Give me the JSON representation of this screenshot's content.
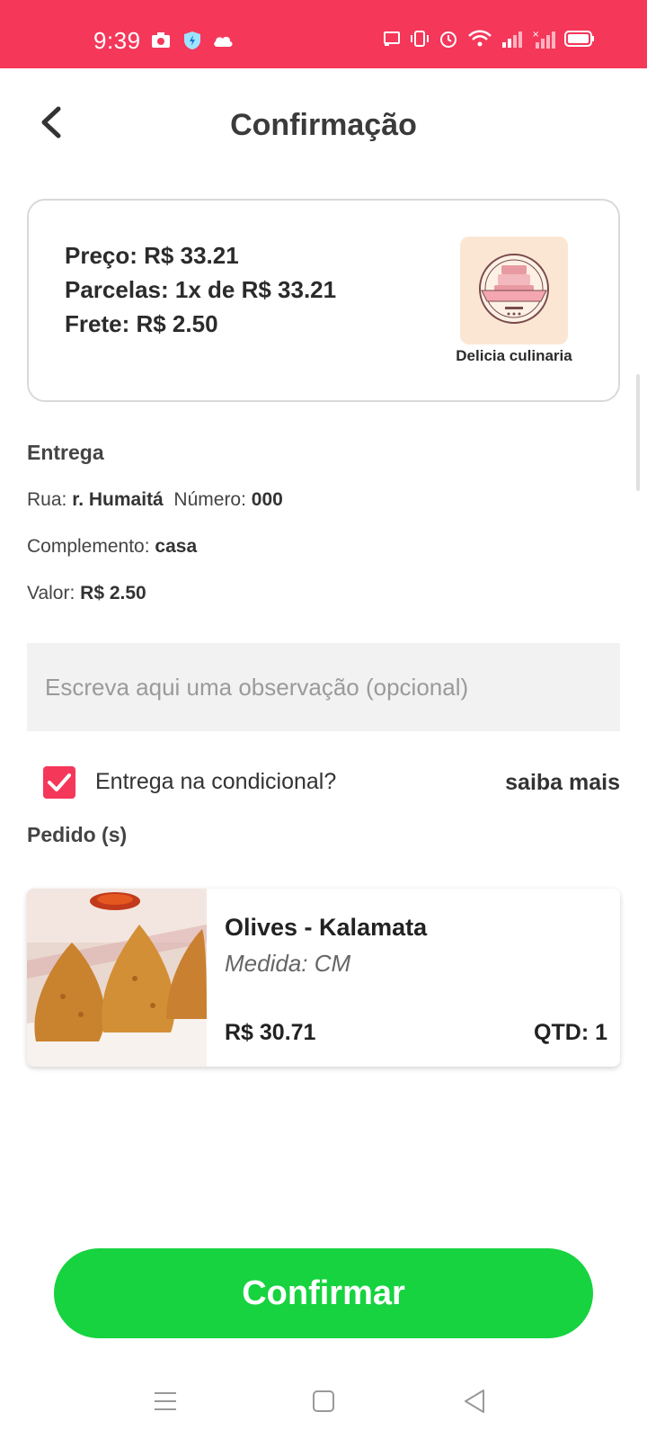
{
  "status_bar": {
    "time": "9:39",
    "bg_color": "#f5375a",
    "left_icons": [
      "camera-icon",
      "shield-icon",
      "cloud-icon"
    ],
    "right_icons": [
      "cast-icon",
      "vibrate-icon",
      "alarm-icon",
      "wifi-icon",
      "signal-icon",
      "signal-off-icon",
      "battery-icon"
    ]
  },
  "header": {
    "title": "Confirmação",
    "back_icon": "chevron-left-icon"
  },
  "summary": {
    "price_label": "Preço: R$ 33.21",
    "installments_label": "Parcelas: 1x de R$ 33.21",
    "shipping_label": "Frete: R$ 2.50",
    "store_name": "Delicia culinaria",
    "store_logo_icon": "bakery-logo-icon"
  },
  "delivery": {
    "title": "Entrega",
    "street_label": "Rua:",
    "street_value": "r. Humaitá",
    "number_label": "Número:",
    "number_value": "000",
    "complement_label": "Complemento:",
    "complement_value": "casa",
    "value_label": "Valor:",
    "value_value": "R$ 2.50"
  },
  "observation": {
    "placeholder": "Escreva aqui uma observação (opcional)",
    "value": ""
  },
  "conditional": {
    "label": "Entrega na condicional?",
    "checked": true,
    "more_link": "saiba mais"
  },
  "orders": {
    "title": "Pedido (s)",
    "items": [
      {
        "name": "Olives - Kalamata",
        "size": "Medida: CM",
        "price": "R$ 30.71",
        "qty": "QTD: 1"
      }
    ]
  },
  "confirm_button": {
    "label": "Confirmar",
    "color": "#16d33f"
  },
  "nav_bar": {
    "icons": [
      "menu-icon",
      "home-square-icon",
      "back-triangle-icon"
    ]
  }
}
